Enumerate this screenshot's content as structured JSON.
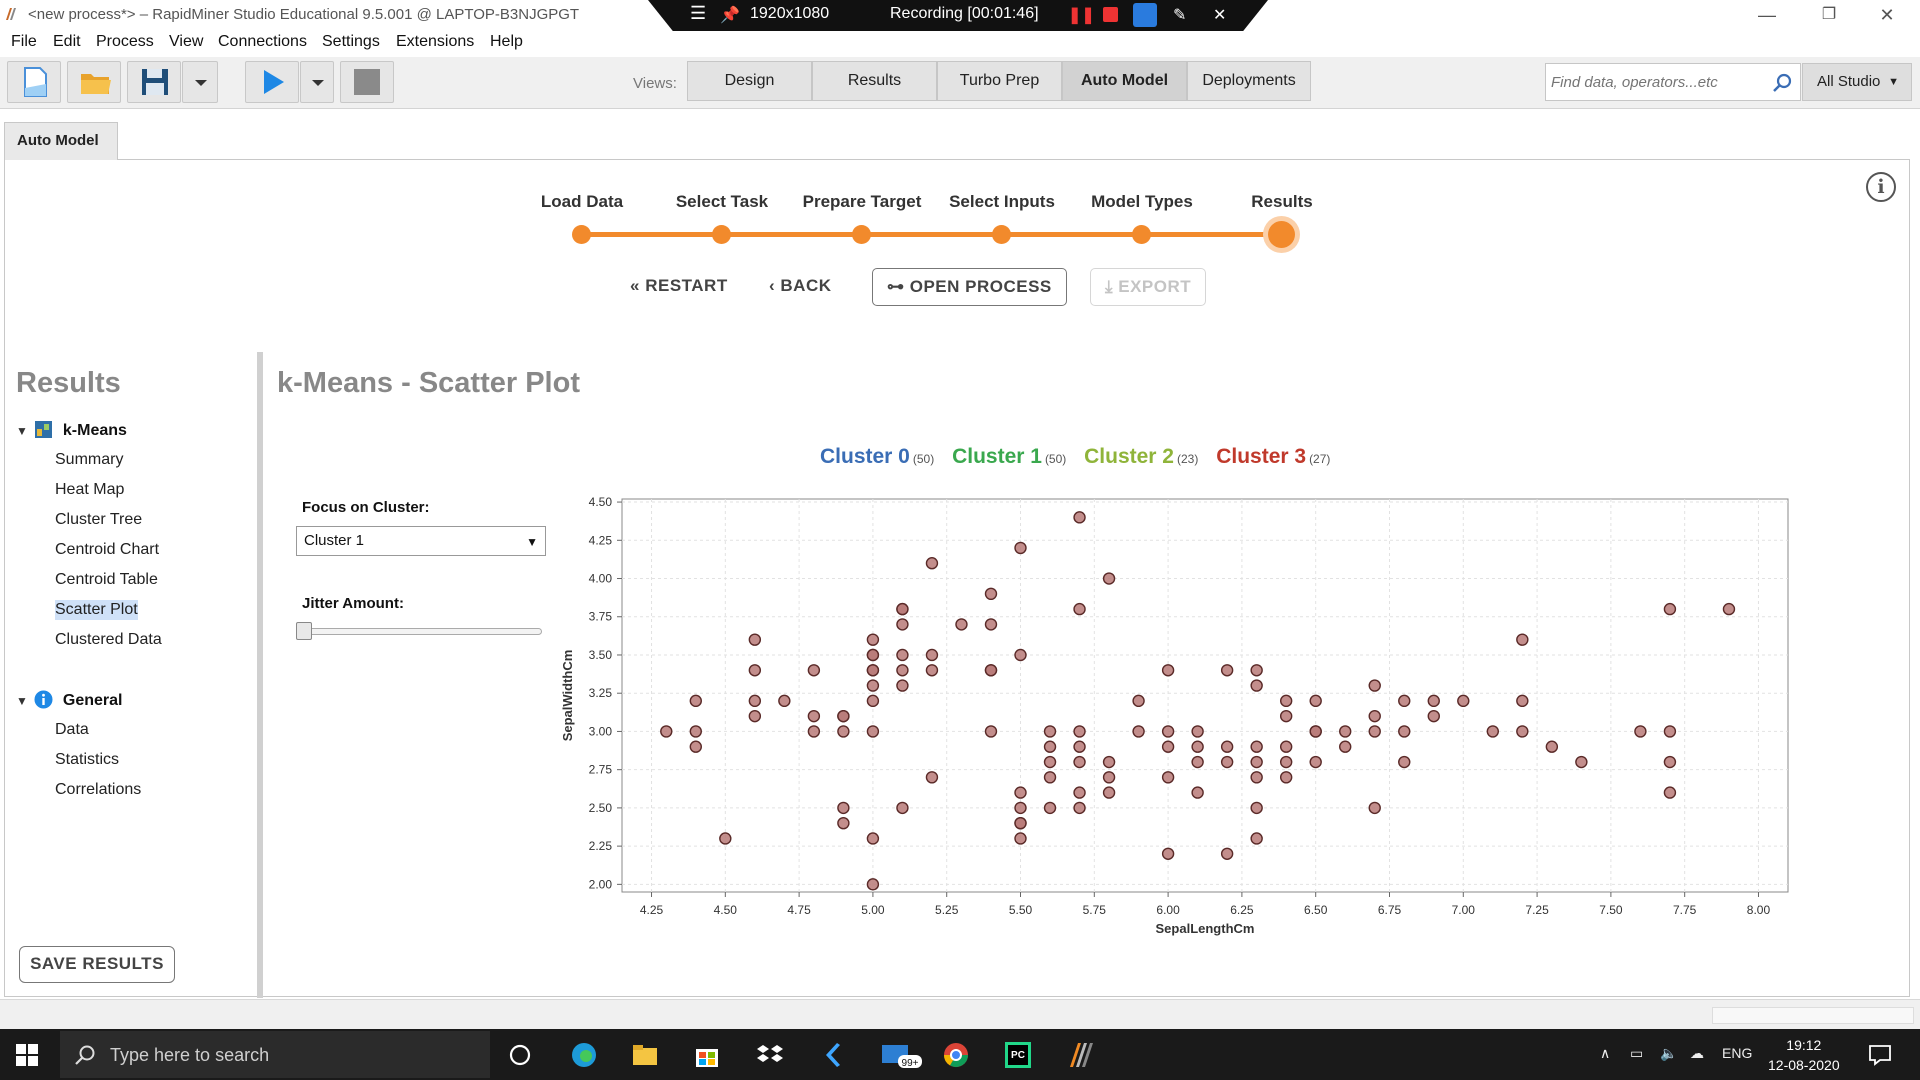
{
  "window": {
    "title": "<new process*> – RapidMiner Studio Educational 9.5.001 @ LAPTOP-B3NJGPGT",
    "minimize_icon": "minimize-icon",
    "restore_icon": "restore-icon",
    "close_icon": "close-icon"
  },
  "recording": {
    "resolution": "1920x1080",
    "status": "Recording [00:01:46]"
  },
  "menu": [
    "File",
    "Edit",
    "Process",
    "View",
    "Connections",
    "Settings",
    "Extensions",
    "Help"
  ],
  "toolbar": {
    "views_label": "Views:",
    "views": [
      "Design",
      "Results",
      "Turbo Prep",
      "Auto Model",
      "Deployments"
    ],
    "active_view": "Auto Model",
    "search_placeholder": "Find data, operators...etc",
    "scope": "All Studio"
  },
  "tab": {
    "label": "Auto Model"
  },
  "stepper": {
    "steps": [
      "Load Data",
      "Select Task",
      "Prepare Target",
      "Select Inputs",
      "Model Types",
      "Results"
    ],
    "current": "Results",
    "restart": "RESTART",
    "back": "BACK",
    "open_process": "OPEN PROCESS",
    "export": "EXPORT"
  },
  "sidebar": {
    "heading": "Results",
    "groups": [
      {
        "label": "k-Means",
        "items": [
          "Summary",
          "Heat Map",
          "Cluster Tree",
          "Centroid Chart",
          "Centroid Table",
          "Scatter Plot",
          "Clustered Data"
        ]
      },
      {
        "label": "General",
        "items": [
          "Data",
          "Statistics",
          "Correlations"
        ]
      }
    ],
    "selected_item": "Scatter Plot",
    "save_button": "SAVE RESULTS"
  },
  "main": {
    "title": "k-Means - Scatter Plot",
    "legend": [
      {
        "name": "Cluster 0",
        "count": "(50)",
        "color": "#3a6db5"
      },
      {
        "name": "Cluster 1",
        "count": "(50)",
        "color": "#3aa84e"
      },
      {
        "name": "Cluster 2",
        "count": "(23)",
        "color": "#8fb43a"
      },
      {
        "name": "Cluster 3",
        "count": "(27)",
        "color": "#c0392b"
      }
    ],
    "focus_label": "Focus on Cluster:",
    "focus_value": "Cluster 1",
    "jitter_label": "Jitter Amount:",
    "jitter_value": 0
  },
  "chart_data": {
    "type": "scatter",
    "xlabel": "SepalLengthCm",
    "ylabel": "SepalWidthCm",
    "xlim": [
      4.15,
      8.1
    ],
    "ylim": [
      1.95,
      4.52
    ],
    "xticks": [
      "4.25",
      "4.50",
      "4.75",
      "5.00",
      "5.25",
      "5.50",
      "5.75",
      "6.00",
      "6.25",
      "6.50",
      "6.75",
      "7.00",
      "7.25",
      "7.50",
      "7.75",
      "8.00"
    ],
    "yticks": [
      "2.00",
      "2.25",
      "2.50",
      "2.75",
      "3.00",
      "3.25",
      "3.50",
      "3.75",
      "4.00",
      "4.25",
      "4.50"
    ],
    "grid": true,
    "point_color": "#b87a78",
    "x": [
      4.3,
      4.4,
      4.4,
      4.4,
      4.5,
      4.6,
      4.6,
      4.6,
      4.6,
      4.7,
      4.8,
      4.8,
      4.8,
      4.9,
      4.9,
      4.9,
      4.9,
      4.9,
      5.0,
      5.0,
      5.0,
      5.0,
      5.0,
      5.0,
      5.0,
      5.0,
      5.0,
      5.0,
      5.1,
      5.1,
      5.1,
      5.1,
      5.1,
      5.1,
      5.1,
      5.2,
      5.2,
      5.2,
      5.2,
      5.3,
      5.4,
      5.4,
      5.4,
      5.4,
      5.4,
      5.5,
      5.5,
      5.5,
      5.5,
      5.5,
      5.5,
      5.5,
      5.6,
      5.6,
      5.6,
      5.6,
      5.6,
      5.7,
      5.7,
      5.7,
      5.7,
      5.7,
      5.7,
      5.7,
      5.8,
      5.8,
      5.8,
      5.8,
      5.9,
      5.9,
      6.0,
      6.0,
      6.0,
      6.0,
      6.0,
      6.1,
      6.1,
      6.1,
      6.1,
      6.2,
      6.2,
      6.2,
      6.2,
      6.3,
      6.3,
      6.3,
      6.3,
      6.3,
      6.3,
      6.3,
      6.4,
      6.4,
      6.4,
      6.4,
      6.4,
      6.5,
      6.5,
      6.5,
      6.5,
      6.6,
      6.6,
      6.7,
      6.7,
      6.7,
      6.7,
      6.8,
      6.8,
      6.8,
      6.9,
      6.9,
      7.0,
      7.1,
      7.2,
      7.2,
      7.2,
      7.3,
      7.4,
      7.6,
      7.7,
      7.7,
      7.7,
      7.7,
      7.9
    ],
    "y": [
      3.0,
      3.2,
      3.0,
      2.9,
      2.3,
      3.6,
      3.4,
      3.2,
      3.1,
      3.2,
      3.4,
      3.1,
      3.0,
      3.1,
      3.0,
      2.5,
      2.4,
      3.1,
      3.6,
      3.5,
      3.4,
      3.3,
      3.2,
      3.0,
      2.3,
      2.0,
      3.5,
      3.4,
      3.8,
      3.7,
      3.5,
      3.4,
      3.3,
      2.5,
      3.8,
      4.1,
      3.5,
      3.4,
      2.7,
      3.7,
      3.9,
      3.7,
      3.4,
      3.0,
      3.4,
      4.2,
      3.5,
      2.6,
      2.5,
      2.4,
      2.3,
      2.4,
      3.0,
      2.9,
      2.8,
      2.7,
      2.5,
      4.4,
      3.8,
      3.0,
      2.9,
      2.8,
      2.6,
      2.5,
      4.0,
      2.8,
      2.7,
      2.6,
      3.2,
      3.0,
      3.4,
      3.0,
      2.9,
      2.7,
      2.2,
      3.0,
      2.9,
      2.8,
      2.6,
      3.4,
      2.9,
      2.8,
      2.2,
      3.4,
      3.3,
      2.9,
      2.8,
      2.7,
      2.5,
      2.3,
      3.2,
      3.1,
      2.9,
      2.8,
      2.7,
      3.2,
      3.0,
      2.8,
      3.0,
      3.0,
      2.9,
      3.3,
      3.1,
      3.0,
      2.5,
      3.2,
      3.0,
      2.8,
      3.2,
      3.1,
      3.2,
      3.0,
      3.6,
      3.2,
      3.0,
      2.9,
      2.8,
      3.0,
      3.8,
      3.0,
      2.8,
      2.6,
      3.8
    ]
  }
}
